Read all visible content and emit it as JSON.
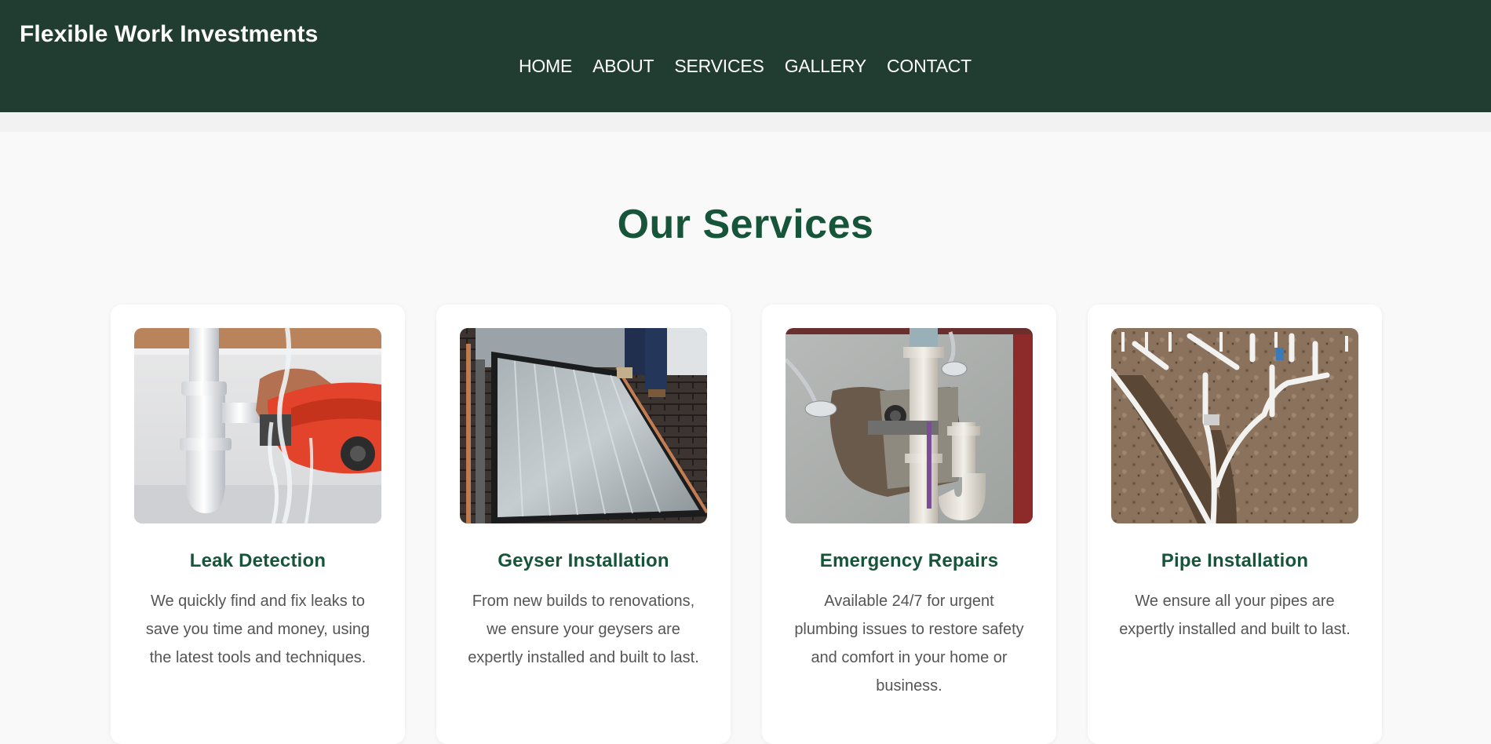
{
  "header": {
    "brand": "Flexible Work Investments",
    "nav": [
      {
        "label": "HOME"
      },
      {
        "label": "ABOUT"
      },
      {
        "label": "SERVICES"
      },
      {
        "label": "GALLERY"
      },
      {
        "label": "CONTACT"
      }
    ]
  },
  "services": {
    "title": "Our Services",
    "cards": [
      {
        "title": "Leak Detection",
        "text": "We quickly find and fix leaks to save you time and money, using the latest tools and techniques.",
        "image": "leaking-sink-pipe-with-wrench"
      },
      {
        "title": "Geyser Installation",
        "text": "From new builds to renovations, we ensure your geysers are expertly installed and built to last.",
        "image": "solar-geyser-panel-on-roof"
      },
      {
        "title": "Emergency Repairs",
        "text": "Available 24/7 for urgent plumbing issues to restore safety and comfort in your home or business.",
        "image": "exposed-drain-pipes-behind-wall"
      },
      {
        "title": "Pipe Installation",
        "text": "We ensure all your pipes are expertly installed and built to last.",
        "image": "pvc-pipes-in-trench"
      }
    ]
  },
  "colors": {
    "header_bg": "#213c30",
    "accent_green": "#17553a",
    "page_bg": "#f9f9f9",
    "body_text": "#555555"
  }
}
